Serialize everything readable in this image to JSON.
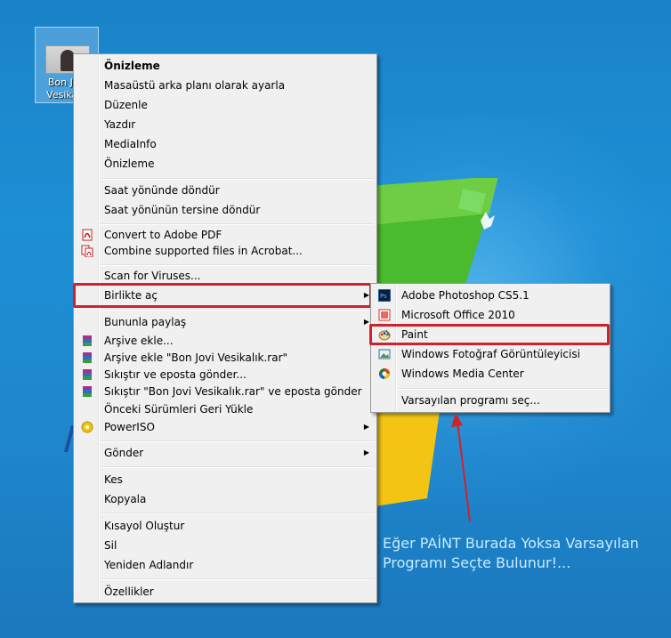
{
  "desktop": {
    "icon_label": "Bon Jovi\nVesikalık"
  },
  "context_menu": {
    "preview_bold": "Önizleme",
    "set_background": "Masaüstü arka planı olarak ayarla",
    "edit": "Düzenle",
    "print": "Yazdır",
    "mediainfo": "MediaInfo",
    "preview": "Önizleme",
    "rotate_cw": "Saat yönünde döndür",
    "rotate_ccw": "Saat yönünün tersine döndür",
    "convert_pdf": "Convert to Adobe PDF",
    "combine_acrobat": "Combine supported files in Acrobat...",
    "scan_viruses": "Scan for Viruses...",
    "open_with": "Birlikte aç",
    "share_with": "Bununla paylaş",
    "add_archive": "Arşive ekle...",
    "add_archive_named": "Arşive ekle \"Bon Jovi Vesikalık.rar\"",
    "compress_email": "Sıkıştır ve eposta gönder...",
    "compress_named_email": "Sıkıştır \"Bon Jovi Vesikalık.rar\" ve eposta gönder",
    "restore_previous": "Önceki Sürümleri Geri Yükle",
    "poweriso": "PowerISO",
    "send_to": "Gönder",
    "cut": "Kes",
    "copy": "Kopyala",
    "create_shortcut": "Kısayol Oluştur",
    "delete": "Sil",
    "rename": "Yeniden Adlandır",
    "properties": "Özellikler"
  },
  "open_with_menu": {
    "photoshop": "Adobe Photoshop CS5.1",
    "office": "Microsoft Office 2010",
    "paint": "Paint",
    "photo_viewer": "Windows Fotoğraf Görüntüleyicisi",
    "media_center": "Windows Media Center",
    "choose_default": "Varsayılan programı seç..."
  },
  "annotation": {
    "line1": "Eğer PAİNT Burada Yoksa Varsayılan",
    "line2": "Programı Seçte Bulunur!..."
  },
  "colors": {
    "highlight": "#d0222b",
    "annotation_text": "#c8ecff",
    "desktop": "#1d8fd4"
  }
}
